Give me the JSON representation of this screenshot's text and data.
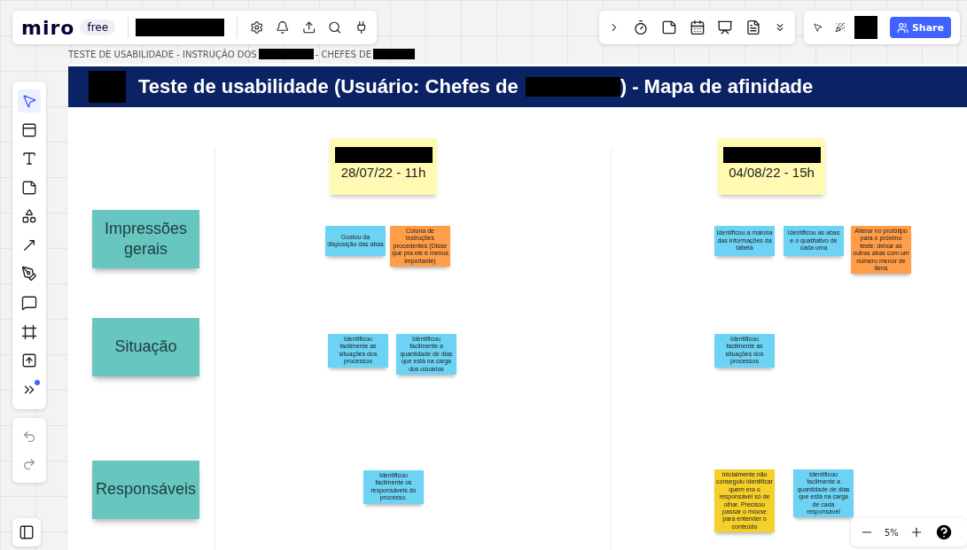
{
  "app": {
    "logo": "miro",
    "plan": "free"
  },
  "breadcrumb": {
    "part_1": "TESTE DE USABILIDADE - INSTRUÇÃO DOS",
    "part_2": "- CHEFES DE"
  },
  "frame": {
    "title_part_1": "Teste de usabilidade (Usuário: Chefes de",
    "title_part_2": ") - Mapa de afinidade"
  },
  "row_labels": [
    "Impressões gerais",
    "Situação",
    "Responsáveis"
  ],
  "sessions": [
    {
      "date": "28/07/22 - 11h",
      "groups": [
        [
          {
            "text": "Gostou da disposição das abas",
            "color": "#6cd3f4"
          },
          {
            "text": "Coluna de instruções procedentes (Disse que pra ele é menos importante)",
            "color": "#ff9d48"
          }
        ],
        [
          {
            "text": "Identificou facilmente as situações dos processos",
            "color": "#6cd3f4"
          },
          {
            "text": "Identificou facilmente a quantidade de dias que está na carga dos usuários",
            "color": "#6cd3f4"
          }
        ],
        [
          {
            "text": "Identificou facilmente os responsáveis do processo.",
            "color": "#6cd3f4"
          }
        ]
      ]
    },
    {
      "date": "04/08/22 - 15h",
      "groups": [
        [
          {
            "text": "Identificou a maioria das informações da tabela",
            "color": "#6cd3f4"
          },
          {
            "text": "Identificou as abas e o quatitativo de cada uma",
            "color": "#6cd3f4"
          },
          {
            "text": "Alterar no protótipo para o próximo teste: deixar as outras abas com um número menor de itens",
            "color": "#ff9d48"
          }
        ],
        [
          {
            "text": "Identificou facilmente as situações dos processos",
            "color": "#6cd3f4"
          }
        ],
        [
          {
            "text": "Inicialmente não conseguiu identificar quem era o responsável só de olhar. Precisou passar o mouse para entender o conteúdo",
            "color": "#f5d02b"
          },
          {
            "text": "Identificou facilmente a quantidade de dias que está na carga de cada responsável",
            "color": "#6cd3f4"
          }
        ]
      ]
    }
  ],
  "tools": [
    {
      "kind": "select",
      "selected": true
    },
    {
      "kind": "templates",
      "selected": false
    },
    {
      "kind": "text",
      "selected": false
    },
    {
      "kind": "sticky",
      "selected": false
    },
    {
      "kind": "shapes",
      "selected": false
    },
    {
      "kind": "arrow",
      "selected": false
    },
    {
      "kind": "pen",
      "selected": false
    },
    {
      "kind": "comment",
      "selected": false
    },
    {
      "kind": "frame",
      "selected": false
    },
    {
      "kind": "upload",
      "selected": false
    },
    {
      "kind": "more",
      "selected": false
    }
  ],
  "share_button": "Share",
  "zoom": "5%"
}
